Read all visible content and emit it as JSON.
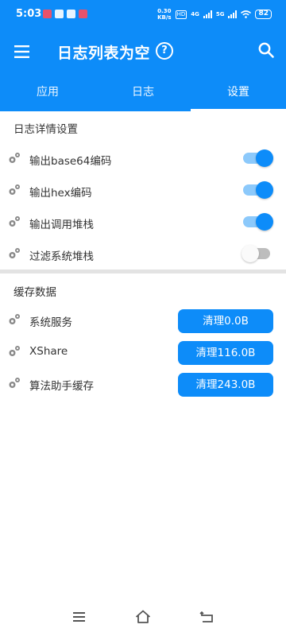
{
  "status_bar": {
    "time": "5:03",
    "net_speed_value": "0.30",
    "net_speed_unit": "KB/s",
    "hd_label": "HD",
    "network_label": "4G",
    "network2_label": "5G",
    "battery": "82"
  },
  "toolbar": {
    "title": "日志列表为空",
    "help_glyph": "?",
    "icons": {
      "menu": "menu-icon",
      "help": "help-circle-icon",
      "search": "search-icon"
    }
  },
  "tabs": [
    {
      "label": "应用"
    },
    {
      "label": "日志"
    },
    {
      "label": "设置",
      "active": true
    }
  ],
  "log_settings": {
    "title": "日志详情设置",
    "items": [
      {
        "label": "输出base64编码",
        "enabled": true
      },
      {
        "label": "输出hex编码",
        "enabled": true
      },
      {
        "label": "输出调用堆栈",
        "enabled": true
      },
      {
        "label": "过滤系统堆栈",
        "enabled": false
      }
    ]
  },
  "cache_data": {
    "title": "缓存数据",
    "items": [
      {
        "label": "系统服务",
        "button": "清理0.0B"
      },
      {
        "label": "XShare",
        "button": "清理116.0B"
      },
      {
        "label": "算法助手缓存",
        "button": "清理243.0B"
      }
    ]
  },
  "nav_bar": {
    "icons": [
      "menu-lines-icon",
      "home-icon",
      "back-icon"
    ]
  },
  "colors": {
    "primary": "#0d8cf9",
    "switch_track_on": "#8cc9fb",
    "switch_off": "#bdbdbd",
    "divider": "#e3e3e3",
    "gear": "#8a8a8a"
  }
}
